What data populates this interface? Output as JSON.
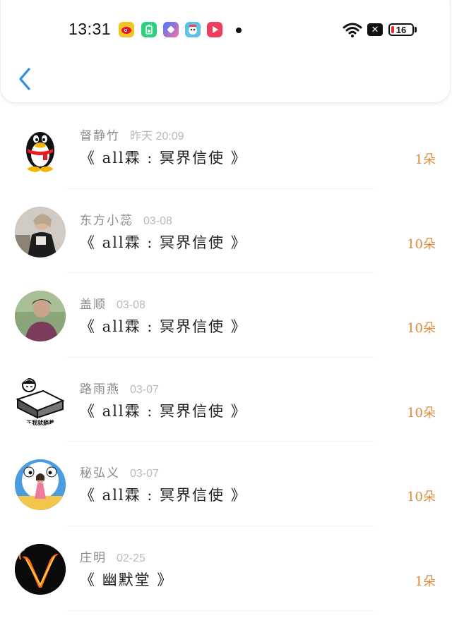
{
  "status_bar": {
    "time": "13:31",
    "battery_level": "16",
    "battery_fraction": 0.16,
    "icons": [
      "weibo-icon",
      "battery-saver-app-icon",
      "shortcut-app-icon",
      "game-app-icon",
      "video-app-icon",
      "notification-dot",
      "wifi-icon",
      "close-box-icon",
      "battery-icon"
    ]
  },
  "nav": {
    "back_icon": "chevron-left-icon"
  },
  "colors": {
    "accent": "#2b8fe0",
    "flower_count": "#e08a3c",
    "username": "#8a8a8a",
    "date": "#b9b9b9"
  },
  "items": [
    {
      "user": "督静竹",
      "date": "昨天 20:09",
      "book": "《 all霖 : 冥界信使 》",
      "flowers": "1朵",
      "avatar": "qq-penguin-avatar"
    },
    {
      "user": "东方小蕊",
      "date": "03-08",
      "book": "《 all霖 : 冥界信使 》",
      "flowers": "10朵",
      "avatar": "photo-avatar"
    },
    {
      "user": "盖顺",
      "date": "03-08",
      "book": "《 all霖 : 冥界信使 》",
      "flowers": "10朵",
      "avatar": "photo-avatar"
    },
    {
      "user": "路雨燕",
      "date": "03-07",
      "book": "《 all霖 : 冥界信使 》",
      "flowers": "10朵",
      "avatar": "cartoon-bed-avatar",
      "avatar_caption": "正我就躺着"
    },
    {
      "user": "秘弘义",
      "date": "03-07",
      "book": "《 all霖 : 冥界信使 》",
      "flowers": "10朵",
      "avatar": "doraemon-photo-avatar"
    },
    {
      "user": "庄明",
      "date": "02-25",
      "book": "《 幽默堂 》",
      "flowers": "1朵",
      "avatar": "fire-v-avatar"
    }
  ]
}
